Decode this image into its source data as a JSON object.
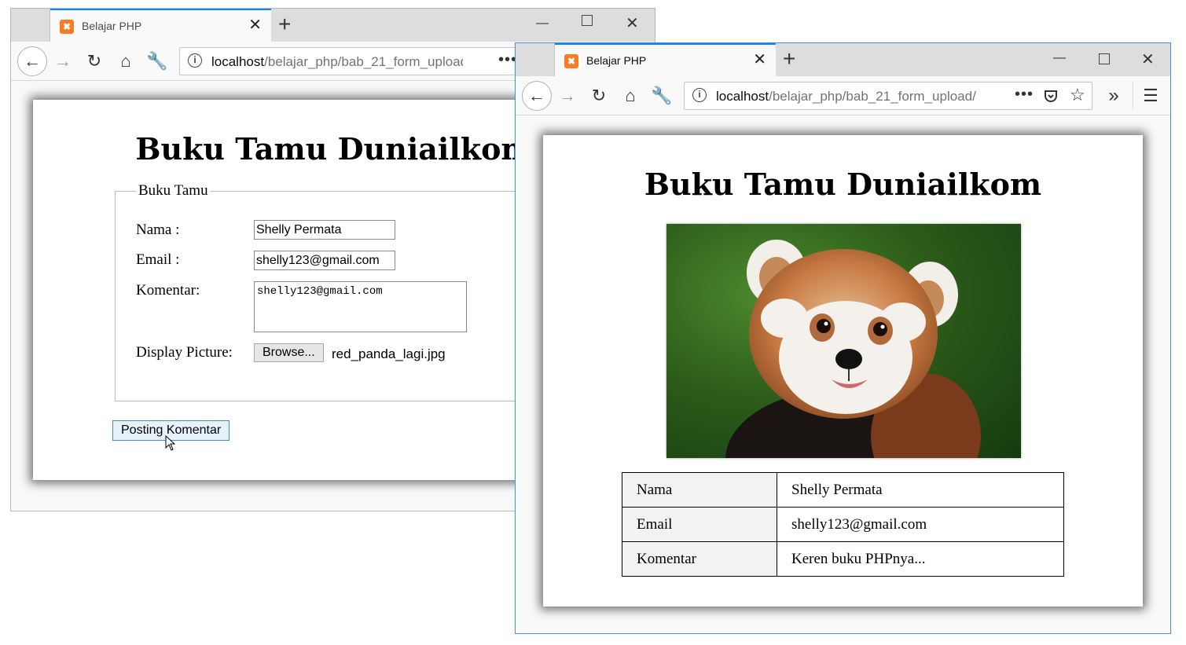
{
  "back_window": {
    "tab_title": "Belajar PHP",
    "url_host": "localhost",
    "url_path": "/belajar_php/bab_21_form_upload",
    "page_title": "Buku Tamu Duniailkom",
    "fieldset_legend": "Buku Tamu",
    "form": {
      "nama_label": "Nama :",
      "nama_value": "Shelly Permata",
      "email_label": "Email :",
      "email_value": "shelly123@gmail.com",
      "komentar_label": "Komentar:",
      "komentar_value": "shelly123@gmail.com",
      "picture_label": "Display Picture:",
      "browse_label": "Browse...",
      "file_name": "red_panda_lagi.jpg",
      "submit_label": "Posting Komentar"
    }
  },
  "front_window": {
    "tab_title": "Belajar PHP",
    "url_host": "localhost",
    "url_path": "/belajar_php/bab_21_form_upload/",
    "page_title": "Buku Tamu Duniailkom",
    "table": [
      {
        "key": "Nama",
        "value": "Shelly Permata"
      },
      {
        "key": "Email",
        "value": "shelly123@gmail.com"
      },
      {
        "key": "Komentar",
        "value": "Keren buku PHPnya..."
      }
    ]
  },
  "icons": {
    "favicon": "xampp-icon",
    "back": "arrow-left-icon",
    "forward": "arrow-right-icon",
    "reload": "reload-icon",
    "home": "home-icon",
    "tools": "wrench-icon"
  },
  "colors": {
    "tab_accent": "#0a84ff",
    "favicon": "#fb7a24",
    "submit_border": "#3d8ad8"
  }
}
